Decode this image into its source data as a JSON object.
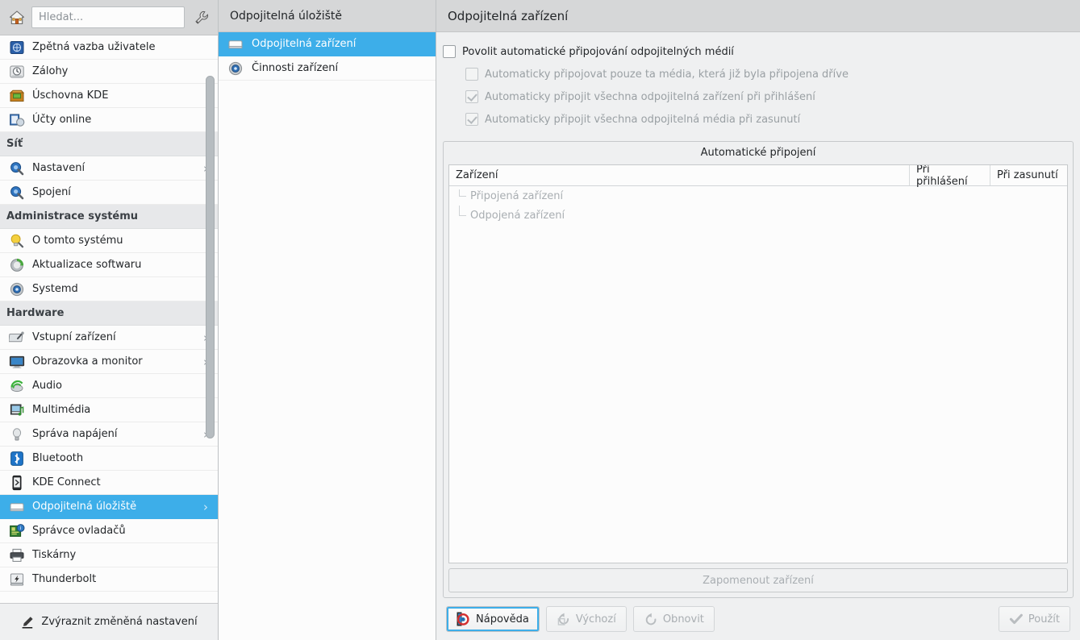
{
  "sidebar": {
    "toolbar": {
      "home_icon": "home-icon",
      "search_placeholder": "Hledat...",
      "search_value": "",
      "configure_icon": "wrench-icon"
    },
    "items": [
      {
        "type": "item",
        "label": "Zpětná vazba uživatele",
        "icon": "user-feedback-icon",
        "arrow": false,
        "selected": false
      },
      {
        "type": "item",
        "label": "Zálohy",
        "icon": "backups-icon",
        "arrow": false,
        "selected": false
      },
      {
        "type": "item",
        "label": "Úschovna KDE",
        "icon": "kde-wallet-icon",
        "arrow": false,
        "selected": false
      },
      {
        "type": "item",
        "label": "Účty online",
        "icon": "online-accounts-icon",
        "arrow": false,
        "selected": false
      },
      {
        "type": "category",
        "label": "Síť"
      },
      {
        "type": "item",
        "label": "Nastavení",
        "icon": "network-settings-icon",
        "arrow": true,
        "selected": false
      },
      {
        "type": "item",
        "label": "Spojení",
        "icon": "network-connections-icon",
        "arrow": false,
        "selected": false
      },
      {
        "type": "category",
        "label": "Administrace systému"
      },
      {
        "type": "item",
        "label": "O tomto systému",
        "icon": "about-system-icon",
        "arrow": false,
        "selected": false
      },
      {
        "type": "item",
        "label": "Aktualizace softwaru",
        "icon": "software-update-icon",
        "arrow": false,
        "selected": false
      },
      {
        "type": "item",
        "label": "Systemd",
        "icon": "systemd-icon",
        "arrow": false,
        "selected": false
      },
      {
        "type": "category",
        "label": "Hardware"
      },
      {
        "type": "item",
        "label": "Vstupní zařízení",
        "icon": "input-devices-icon",
        "arrow": true,
        "selected": false
      },
      {
        "type": "item",
        "label": "Obrazovka a monitor",
        "icon": "display-monitor-icon",
        "arrow": true,
        "selected": false
      },
      {
        "type": "item",
        "label": "Audio",
        "icon": "audio-icon",
        "arrow": false,
        "selected": false
      },
      {
        "type": "item",
        "label": "Multimédia",
        "icon": "multimedia-icon",
        "arrow": false,
        "selected": false
      },
      {
        "type": "item",
        "label": "Správa napájení",
        "icon": "power-management-icon",
        "arrow": true,
        "selected": false
      },
      {
        "type": "item",
        "label": "Bluetooth",
        "icon": "bluetooth-icon",
        "arrow": false,
        "selected": false
      },
      {
        "type": "item",
        "label": "KDE Connect",
        "icon": "kde-connect-icon",
        "arrow": false,
        "selected": false
      },
      {
        "type": "item",
        "label": "Odpojitelná úložiště",
        "icon": "removable-storage-icon",
        "arrow": true,
        "selected": true
      },
      {
        "type": "item",
        "label": "Správce ovladačů",
        "icon": "driver-manager-icon",
        "arrow": false,
        "selected": false
      },
      {
        "type": "item",
        "label": "Tiskárny",
        "icon": "printers-icon",
        "arrow": false,
        "selected": false
      },
      {
        "type": "item",
        "label": "Thunderbolt",
        "icon": "thunderbolt-icon",
        "arrow": false,
        "selected": false
      }
    ],
    "footer": {
      "label": "Zvýraznit změněná nastavení",
      "icon": "highlighter-icon"
    }
  },
  "middle": {
    "header": "Odpojitelná úložiště",
    "items": [
      {
        "label": "Odpojitelná zařízení",
        "icon": "removable-devices-icon",
        "selected": true
      },
      {
        "label": "Činnosti zařízení",
        "icon": "device-actions-icon",
        "selected": false
      }
    ]
  },
  "main": {
    "header": "Odpojitelná zařízení",
    "checkboxes": [
      {
        "label": "Povolit automatické připojování odpojitelných médií",
        "checked": false,
        "disabled": false,
        "sub": false
      },
      {
        "label": "Automaticky připojovat pouze ta média, která již byla připojena dříve",
        "checked": false,
        "disabled": true,
        "sub": true
      },
      {
        "label": "Automaticky připojit všechna odpojitelná zařízení při přihlášení",
        "checked": true,
        "disabled": true,
        "sub": true
      },
      {
        "label": "Automaticky připojit všechna odpojitelná média při zasunutí",
        "checked": true,
        "disabled": true,
        "sub": true
      }
    ],
    "group": {
      "title": "Automatické připojení",
      "columns": [
        "Zařízení",
        "Při přihlášení",
        "Při zasunutí"
      ],
      "rows": [
        {
          "label": "Připojená zařízení",
          "at_login": "",
          "on_attach": ""
        },
        {
          "label": "Odpojená zařízení",
          "at_login": "",
          "on_attach": ""
        }
      ],
      "forget_button": "Zapomenout zařízení"
    },
    "footer_buttons": [
      {
        "label": "Nápověda",
        "icon": "help-icon",
        "disabled": false,
        "focused": true
      },
      {
        "label": "Výchozí",
        "icon": "defaults-icon",
        "disabled": true,
        "focused": false
      },
      {
        "label": "Obnovit",
        "icon": "reset-icon",
        "disabled": true,
        "focused": false
      }
    ],
    "apply_button": {
      "label": "Použít",
      "icon": "apply-check-icon",
      "disabled": true
    }
  },
  "colors": {
    "selection": "#3daee9",
    "header_bar": "#d6d7d8",
    "panel_bg": "#eff0f1",
    "list_bg": "#fcfcfc",
    "disabled_text": "#9aa0a4"
  }
}
